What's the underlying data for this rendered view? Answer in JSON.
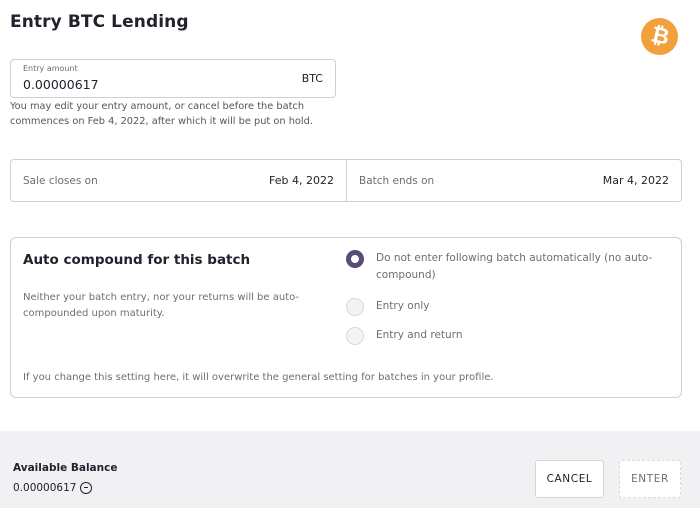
{
  "header": {
    "title": "Entry BTC Lending",
    "logo_icon": "bitcoin-icon",
    "logo_symbol": "₿",
    "logo_color": "#f2a03c"
  },
  "entry": {
    "label": "Entry amount",
    "value": "0.00000617",
    "unit": "BTC",
    "help": "You may edit your entry amount, or cancel before the batch commences on Feb 4, 2022, after which it will be put on hold."
  },
  "dates": {
    "sale_label": "Sale closes on",
    "sale_value": "Feb 4, 2022",
    "batch_label": "Batch ends on",
    "batch_value": "Mar 4, 2022"
  },
  "compound": {
    "title": "Auto compound for this batch",
    "description": "Neither your batch entry, nor your returns will be auto-compounded upon maturity.",
    "options": [
      {
        "label": "Do not enter following batch automatically (no auto-compound)",
        "checked": true
      },
      {
        "label": "Entry only",
        "checked": false
      },
      {
        "label": "Entry and return",
        "checked": false
      }
    ],
    "note": "If you change this setting here, it will overwrite the general setting for batches in your profile.",
    "accent_color": "#5a4a78"
  },
  "footer": {
    "balance_label": "Available Balance",
    "balance_value": "0.00000617",
    "balance_icon": "currency-icon",
    "cancel_label": "CANCEL",
    "enter_label": "ENTER"
  }
}
